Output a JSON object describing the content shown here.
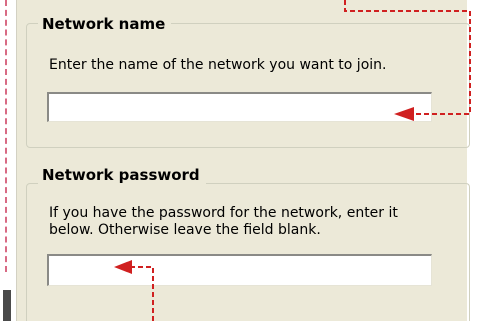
{
  "network_name": {
    "legend": "Network name",
    "description": "Enter the name of the network you want to join.",
    "input_value": "",
    "input_placeholder": ""
  },
  "network_password": {
    "legend": "Network password",
    "description": "If you have the password for the network, enter it\nbelow. Otherwise leave the field blank.",
    "input_value": "",
    "input_placeholder": ""
  },
  "annotation": {
    "color": "#d02020",
    "icons": [
      "callout-arrow-icon",
      "callout-arrow-icon"
    ]
  },
  "colors": {
    "dialog_background": "#ece9d8",
    "groupbox_border": "#d0d0bf",
    "margin_dash": "#d86a84"
  }
}
